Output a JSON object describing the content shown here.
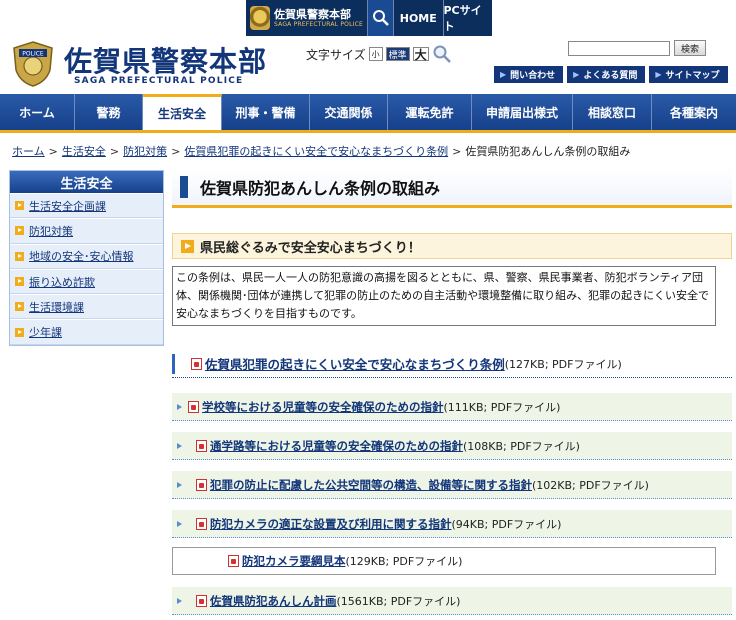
{
  "topbar": {
    "title": "佐賀県警察本部",
    "subtitle": "SAGA PREFECTURAL POLICE",
    "buttons": [
      "HOME",
      "PCサイト"
    ]
  },
  "header": {
    "title": "佐賀県警察本部",
    "subtitle": "SAGA PREFECTURAL POLICE",
    "emblem_text": "POLICE",
    "fontsize_label": "文字サイズ",
    "fontsize_small": "小",
    "fontsize_std": "標準",
    "fontsize_big": "大",
    "search_button": "検索",
    "search_value": "",
    "util_links": [
      "問い合わせ",
      "よくある質問",
      "サイトマップ"
    ]
  },
  "nav": {
    "items": [
      "ホーム",
      "警務",
      "生活安全",
      "刑事・警備",
      "交通関係",
      "運転免許",
      "申請届出様式",
      "相談窓口",
      "各種案内"
    ],
    "active_index": 2
  },
  "breadcrumb": {
    "items": [
      "ホーム",
      "生活安全",
      "防犯対策",
      "佐賀県犯罪の起きにくい安全で安心なまちづくり条例"
    ],
    "current": "佐賀県防犯あんしん条例の取組み"
  },
  "sidebar": {
    "heading": "生活安全",
    "items": [
      "生活安全企画課",
      "防犯対策",
      "地域の安全･安心情報",
      "振り込め詐欺",
      "生活環境課",
      "少年課"
    ]
  },
  "content": {
    "page_title": "佐賀県防犯あんしん条例の取組み",
    "section_heading": "県民総ぐるみで安全安心まちづくり！",
    "intro": "この条例は、県民一人一人の防犯意識の高揚を図るとともに、県、警察、県民事業者、防犯ボランティア団体、関係機関･団体が連携して犯罪の防止のための自主活動や環境整備に取り組み、犯罪の起きにくい安全で安心なまちづくりを目指すものです。",
    "main_link": {
      "text": "佐賀県犯罪の起きにくい安全で安心なまちづくり条例",
      "meta": "(127KB; PDFファイル)"
    },
    "links": [
      {
        "text": "学校等における児童等の安全確保のための指針",
        "meta": "(111KB; PDFファイル)"
      },
      {
        "text": "通学路等における児童等の安全確保のための指針",
        "meta": "(108KB; PDFファイル)"
      },
      {
        "text": "犯罪の防止に配慮した公共空間等の構造、設備等に関する指針",
        "meta": "(102KB; PDFファイル)"
      },
      {
        "text": "防犯カメラの適正な設置及び利用に関する指針",
        "meta": "(94KB; PDFファイル)"
      }
    ],
    "sub_link": {
      "text": "防犯カメラ要綱見本",
      "meta": "(129KB; PDFファイル)"
    },
    "last_link": {
      "text": "佐賀県防犯あんしん計画",
      "meta": "(1561KB; PDFファイル)"
    }
  },
  "colors": {
    "brand_navy": "#13367a",
    "nav_blue": "#1a4a92",
    "accent_orange": "#f0ad19",
    "row_green": "#eef5e6"
  }
}
